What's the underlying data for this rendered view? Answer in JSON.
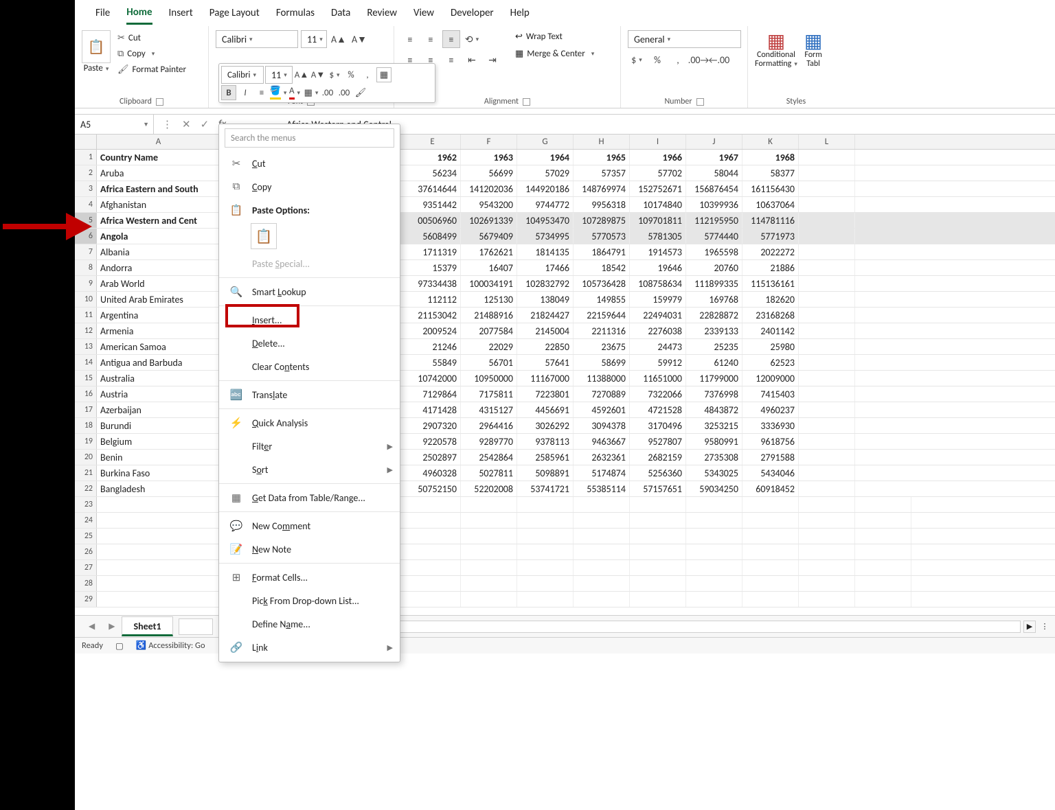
{
  "tabs": [
    "File",
    "Home",
    "Insert",
    "Page Layout",
    "Formulas",
    "Data",
    "Review",
    "View",
    "Developer",
    "Help"
  ],
  "active_tab": "Home",
  "clipboard": {
    "paste": "Paste",
    "cut": "Cut",
    "copy": "Copy",
    "format_painter": "Format Painter",
    "group": "Clipboard"
  },
  "font": {
    "name": "Calibri",
    "size": "11",
    "group": "Font"
  },
  "alignment": {
    "wrap": "Wrap Text",
    "merge": "Merge & Center",
    "group": "Alignment"
  },
  "number": {
    "format": "General",
    "group": "Number"
  },
  "styles": {
    "conditional_formatting": "Conditional\nFormatting",
    "format_table": "Format as\nTable",
    "group": "Styles"
  },
  "namebox": "A5",
  "formula": "Africa Western and Central",
  "mini": {
    "font": "Calibri",
    "size": "11"
  },
  "context_menu": {
    "search_placeholder": "Search the menus",
    "cut": "Cut",
    "copy": "Copy",
    "paste_options": "Paste Options:",
    "paste_special": "Paste Special...",
    "smart_lookup": "Smart Lookup",
    "insert": "Insert...",
    "delete": "Delete...",
    "clear_contents": "Clear Contents",
    "translate": "Translate",
    "quick_analysis": "Quick Analysis",
    "filter": "Filter",
    "sort": "Sort",
    "get_data": "Get Data from Table/Range...",
    "new_comment": "New Comment",
    "new_note": "New Note",
    "format_cells": "Format Cells...",
    "pick": "Pick From Drop-down List...",
    "define_name": "Define Name...",
    "link": "Link"
  },
  "columns": [
    "A",
    "E",
    "F",
    "G",
    "H",
    "I",
    "J",
    "K",
    "L"
  ],
  "col_years": [
    "1962",
    "1963",
    "1964",
    "1965",
    "1966",
    "1967",
    "1968"
  ],
  "rows": [
    {
      "n": 1,
      "a": "Country Name",
      "bold": true,
      "v": [
        "1962",
        "1963",
        "1964",
        "1965",
        "1966",
        "1967",
        "1968"
      ]
    },
    {
      "n": 2,
      "a": "Aruba",
      "v": [
        "56234",
        "56699",
        "57029",
        "57357",
        "57702",
        "58044",
        "58377"
      ]
    },
    {
      "n": 3,
      "a": "Africa Eastern and South",
      "bold": true,
      "v": [
        "37614644",
        "141202036",
        "144920186",
        "148769974",
        "152752671",
        "156876454",
        "161156430"
      ]
    },
    {
      "n": 4,
      "a": "Afghanistan",
      "v": [
        "9351442",
        "9543200",
        "9744772",
        "9956318",
        "10174840",
        "10399936",
        "10637064"
      ]
    },
    {
      "n": 5,
      "a": "Africa Western and Cent",
      "bold": true,
      "sel": true,
      "v": [
        "00506960",
        "102691339",
        "104953470",
        "107289875",
        "109701811",
        "112195950",
        "114781116"
      ]
    },
    {
      "n": 6,
      "a": "Angola",
      "bold": true,
      "sel": true,
      "v": [
        "5608499",
        "5679409",
        "5734995",
        "5770573",
        "5781305",
        "5774440",
        "5771973"
      ]
    },
    {
      "n": 7,
      "a": "Albania",
      "v": [
        "1711319",
        "1762621",
        "1814135",
        "1864791",
        "1914573",
        "1965598",
        "2022272"
      ]
    },
    {
      "n": 8,
      "a": "Andorra",
      "v": [
        "15379",
        "16407",
        "17466",
        "18542",
        "19646",
        "20760",
        "21886"
      ]
    },
    {
      "n": 9,
      "a": "Arab World",
      "v": [
        "97334438",
        "100034191",
        "102832792",
        "105736428",
        "108758634",
        "111899335",
        "115136161"
      ]
    },
    {
      "n": 10,
      "a": "United Arab Emirates",
      "v": [
        "112112",
        "125130",
        "138049",
        "149855",
        "159979",
        "169768",
        "182620"
      ]
    },
    {
      "n": 11,
      "a": "Argentina",
      "v": [
        "21153042",
        "21488916",
        "21824427",
        "22159644",
        "22494031",
        "22828872",
        "23168268"
      ]
    },
    {
      "n": 12,
      "a": "Armenia",
      "v": [
        "2009524",
        "2077584",
        "2145004",
        "2211316",
        "2276038",
        "2339133",
        "2401142"
      ]
    },
    {
      "n": 13,
      "a": "American Samoa",
      "v": [
        "21246",
        "22029",
        "22850",
        "23675",
        "24473",
        "25235",
        "25980"
      ]
    },
    {
      "n": 14,
      "a": "Antigua and Barbuda",
      "v": [
        "55849",
        "56701",
        "57641",
        "58699",
        "59912",
        "61240",
        "62523"
      ]
    },
    {
      "n": 15,
      "a": "Australia",
      "v": [
        "10742000",
        "10950000",
        "11167000",
        "11388000",
        "11651000",
        "11799000",
        "12009000"
      ]
    },
    {
      "n": 16,
      "a": "Austria",
      "v": [
        "7129864",
        "7175811",
        "7223801",
        "7270889",
        "7322066",
        "7376998",
        "7415403"
      ]
    },
    {
      "n": 17,
      "a": "Azerbaijan",
      "v": [
        "4171428",
        "4315127",
        "4456691",
        "4592601",
        "4721528",
        "4843872",
        "4960237"
      ]
    },
    {
      "n": 18,
      "a": "Burundi",
      "v": [
        "2907320",
        "2964416",
        "3026292",
        "3094378",
        "3170496",
        "3253215",
        "3336930"
      ]
    },
    {
      "n": 19,
      "a": "Belgium",
      "v": [
        "9220578",
        "9289770",
        "9378113",
        "9463667",
        "9527807",
        "9580991",
        "9618756"
      ]
    },
    {
      "n": 20,
      "a": "Benin",
      "v": [
        "2502897",
        "2542864",
        "2585961",
        "2632361",
        "2682159",
        "2735308",
        "2791588"
      ]
    },
    {
      "n": 21,
      "a": "Burkina Faso",
      "v": [
        "4960328",
        "5027811",
        "5098891",
        "5174874",
        "5256360",
        "5343025",
        "5434046"
      ]
    },
    {
      "n": 22,
      "a": "Bangladesh",
      "v": [
        "50752150",
        "52202008",
        "53741721",
        "55385114",
        "57157651",
        "59034250",
        "60918452"
      ]
    },
    {
      "n": 23,
      "a": "",
      "v": [
        "",
        "",
        "",
        "",
        "",
        "",
        "",
        ""
      ]
    },
    {
      "n": 24,
      "a": "",
      "v": [
        "",
        "",
        "",
        "",
        "",
        "",
        "",
        ""
      ]
    },
    {
      "n": 25,
      "a": "",
      "v": [
        "",
        "",
        "",
        "",
        "",
        "",
        "",
        ""
      ]
    },
    {
      "n": 26,
      "a": "",
      "v": [
        "",
        "",
        "",
        "",
        "",
        "",
        "",
        ""
      ]
    },
    {
      "n": 27,
      "a": "",
      "v": [
        "",
        "",
        "",
        "",
        "",
        "",
        "",
        ""
      ]
    },
    {
      "n": 28,
      "a": "",
      "v": [
        "",
        "",
        "",
        "",
        "",
        "",
        "",
        ""
      ]
    },
    {
      "n": 29,
      "a": "",
      "v": [
        "",
        "",
        "",
        "",
        "",
        "",
        "",
        ""
      ]
    }
  ],
  "sheet_tab": "Sheet1",
  "status": {
    "ready": "Ready",
    "accessibility": "Accessibility: Go"
  }
}
